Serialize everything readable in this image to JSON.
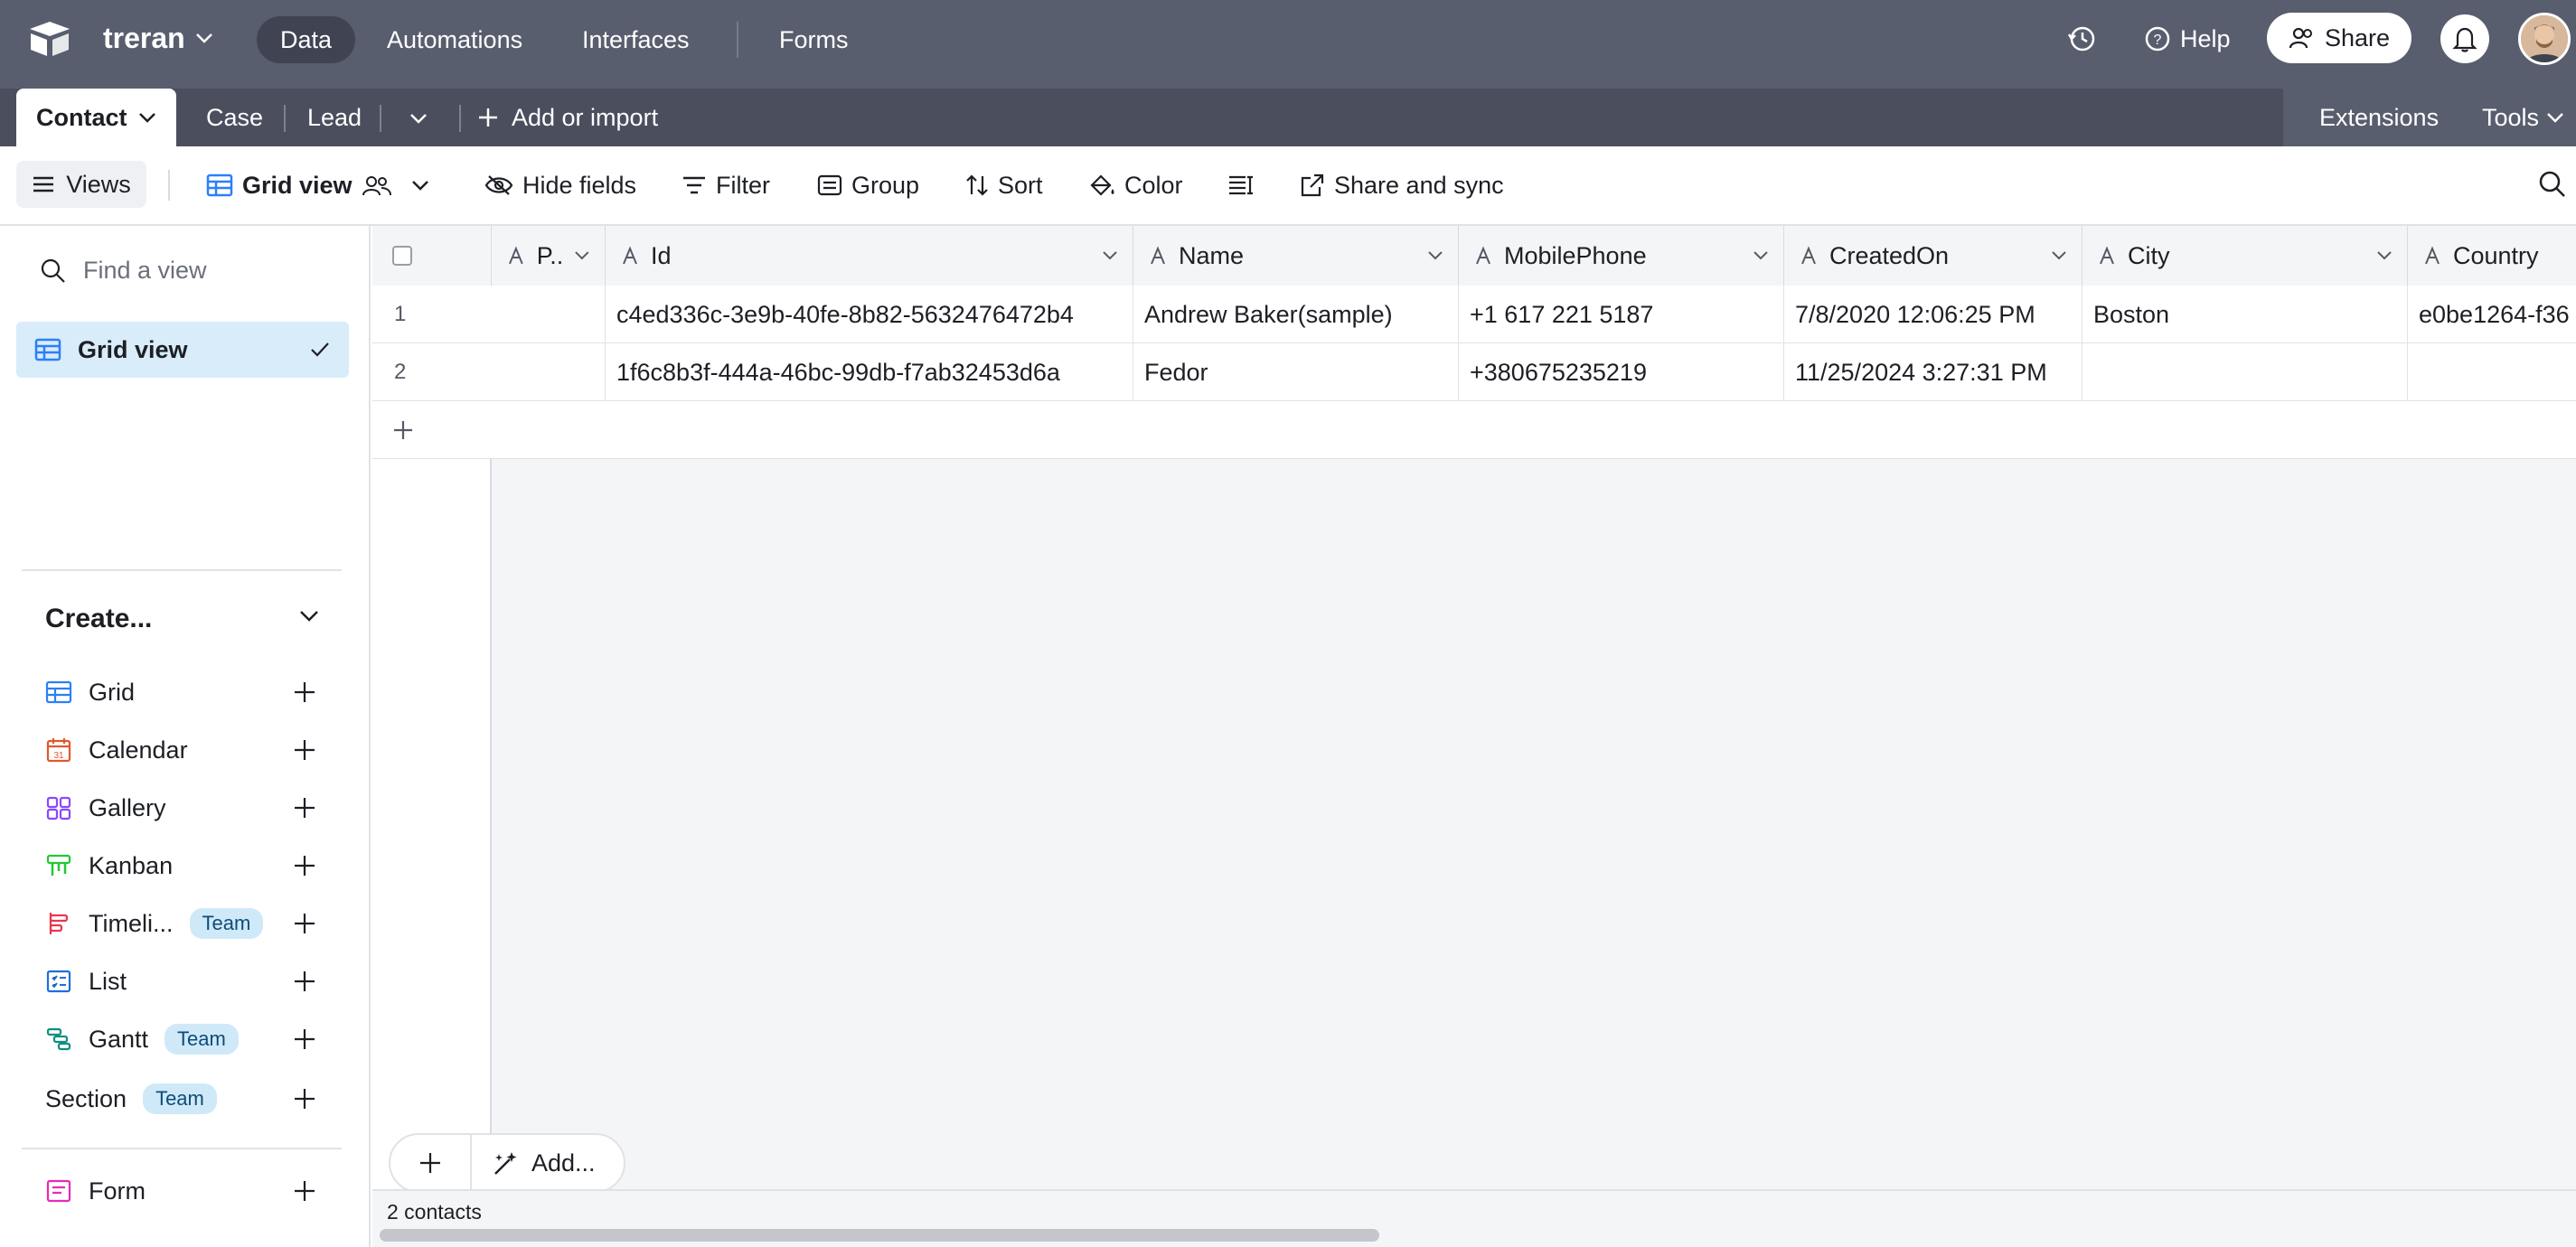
{
  "app": {
    "base_name": "treran",
    "nav_tabs": [
      "Data",
      "Automations",
      "Interfaces",
      "Forms"
    ],
    "help_label": "Help",
    "share_label": "Share"
  },
  "tables": {
    "tabs": [
      "Contact",
      "Case",
      "Lead"
    ],
    "add_import": "Add or import",
    "extensions": "Extensions",
    "tools": "Tools"
  },
  "toolbar": {
    "views": "Views",
    "view_name": "Grid view",
    "hide_fields": "Hide fields",
    "filter": "Filter",
    "group": "Group",
    "sort": "Sort",
    "color": "Color",
    "share_sync": "Share and sync"
  },
  "sidebar": {
    "find_placeholder": "Find a view",
    "selected_view": "Grid view",
    "create_heading": "Create...",
    "team_badge": "Team",
    "create_items": [
      "Grid",
      "Calendar",
      "Gallery",
      "Kanban",
      "Timeli...",
      "List",
      "Gantt",
      "Section",
      "Form"
    ]
  },
  "grid": {
    "columns": [
      "P..",
      "Id",
      "Name",
      "MobilePhone",
      "CreatedOn",
      "City",
      "Country"
    ],
    "rows": [
      {
        "num": "1",
        "p": "",
        "id": "c4ed336c-3e9b-40fe-8b82-5632476472b4",
        "name": "Andrew Baker(sample)",
        "phone": "+1 617 221 5187",
        "created": "7/8/2020 12:06:25 PM",
        "city": "Boston",
        "country": "e0be1264-f36"
      },
      {
        "num": "2",
        "p": "",
        "id": "1f6c8b3f-444a-46bc-99db-f7ab32453d6a",
        "name": "Fedor",
        "phone": "+380675235219",
        "created": "11/25/2024 3:27:31 PM",
        "city": "",
        "country": ""
      }
    ],
    "add_label": "Add...",
    "footer_count": "2 contacts"
  },
  "colors": {
    "topbar": "#595e6e",
    "accent_blue": "#2d7ff9",
    "selected_view_bg": "#d8ecfa"
  }
}
